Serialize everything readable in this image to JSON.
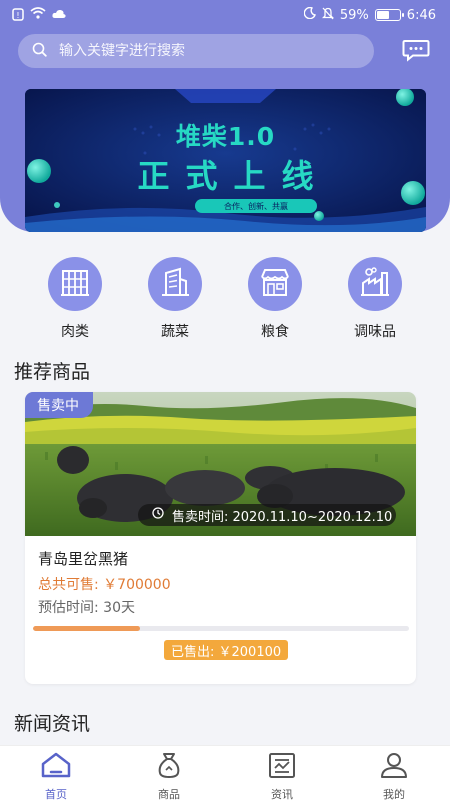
{
  "status_bar": {
    "battery_percent": "59%",
    "time": "6:46",
    "battery_level": 0.59
  },
  "search": {
    "placeholder": "输入关键字进行搜索"
  },
  "banner": {
    "title_line1": "堆柴1.0",
    "title_line2": "正式上线",
    "tagline": "合作、创新、共赢"
  },
  "categories": [
    {
      "label": "肉类",
      "icon": "building-icon"
    },
    {
      "label": "蔬菜",
      "icon": "skyscraper-icon"
    },
    {
      "label": "粮食",
      "icon": "storefront-icon"
    },
    {
      "label": "调味品",
      "icon": "factory-icon"
    }
  ],
  "sections": {
    "recommended": "推荐商品",
    "news": "新闻资讯"
  },
  "product": {
    "badge": "售卖中",
    "sale_time": "售卖时间: 2020.11.10~2020.12.10",
    "name": "青岛里岔黑猪",
    "total": "总共可售: ￥700000",
    "estimated": "预估时间:  30天",
    "sold": "已售出: ￥200100",
    "sold_fraction": 0.2859
  },
  "tabs": [
    {
      "label": "首页",
      "icon": "home-icon",
      "active": true
    },
    {
      "label": "商品",
      "icon": "bag-icon",
      "active": false
    },
    {
      "label": "资讯",
      "icon": "news-icon",
      "active": false
    },
    {
      "label": "我的",
      "icon": "user-icon",
      "active": false
    }
  ],
  "colors": {
    "primary": "#7a80d9",
    "accent_orange": "#e07b35",
    "sold_badge": "#f3a83c",
    "banner_text": "#27d9c4"
  }
}
